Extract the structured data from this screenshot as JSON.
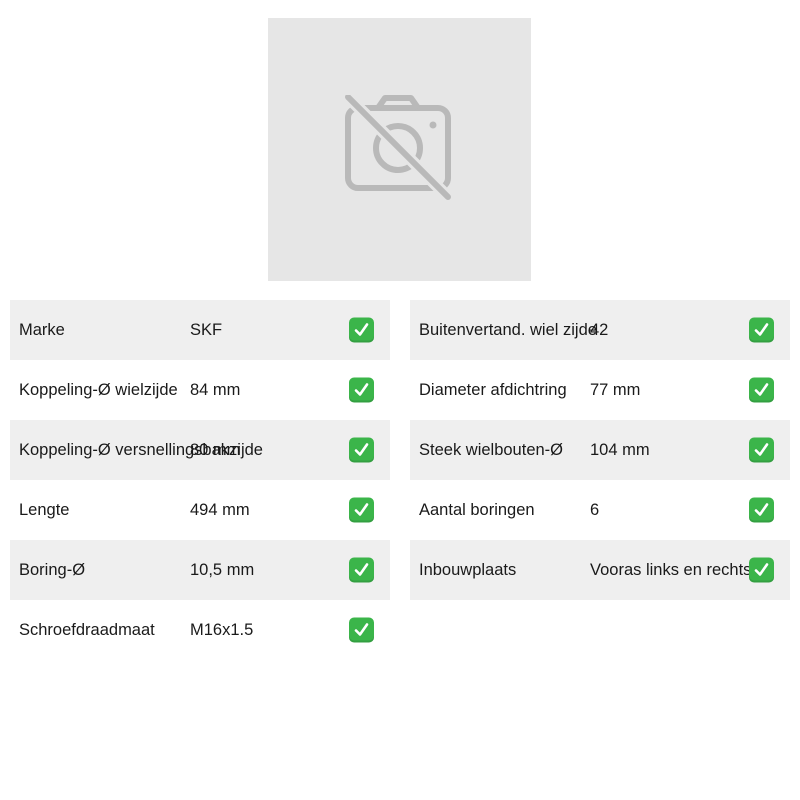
{
  "product_image": {
    "icon": "camera-off-icon"
  },
  "accent_check_color": "#3bb54a",
  "left_specs": [
    {
      "label": "Marke",
      "value": "SKF"
    },
    {
      "label": "Koppeling-Ø wielzijde",
      "value": "84 mm"
    },
    {
      "label": "Koppeling-Ø versnellingsbakzijde",
      "value": "80 mm"
    },
    {
      "label": "Lengte",
      "value": "494 mm"
    },
    {
      "label": "Boring-Ø",
      "value": "10,5 mm"
    },
    {
      "label": "Schroefdraadmaat",
      "value": "M16x1.5"
    }
  ],
  "right_specs": [
    {
      "label": "Buitenvertand. wiel zijde",
      "value": "42"
    },
    {
      "label": "Diameter afdichtring",
      "value": "77 mm"
    },
    {
      "label": "Steek wielbouten-Ø",
      "value": "104 mm"
    },
    {
      "label": "Aantal boringen",
      "value": "6"
    },
    {
      "label": "Inbouwplaats",
      "value": "Vooras links en rechts"
    }
  ]
}
